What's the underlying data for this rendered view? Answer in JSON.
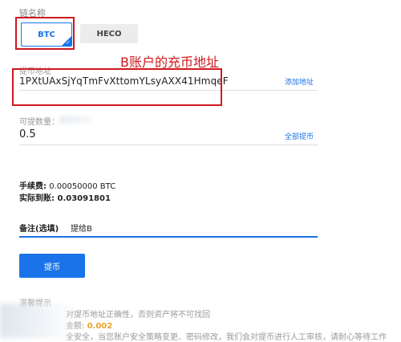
{
  "chain": {
    "label": "链名称",
    "options": [
      {
        "label": "BTC",
        "selected": true
      },
      {
        "label": "HECO",
        "selected": false
      }
    ],
    "checkmark": "✓"
  },
  "annotation": "B账户的充币地址",
  "address": {
    "label": "提币地址",
    "value": "1PXtUAxSjYqTmFvXttomYLsyAXX41HmqeF",
    "add_link": "添加地址"
  },
  "amount": {
    "label": "可提数量：",
    "value": "0.5",
    "all_link": "全部提币"
  },
  "fee": {
    "label": "手续费:",
    "value": "0.00050000 BTC"
  },
  "received": {
    "label": "实际到账:",
    "value": "0.03091801"
  },
  "memo": {
    "label": "备注(选填)",
    "value": "提给B"
  },
  "submit_label": "提币",
  "tips": {
    "title": "温馨提示",
    "line1": "对提币地址正确性，否则资产将不可找回",
    "line2_prefix": "金额:",
    "line2_value": "0.002",
    "line3": "全安全，当您账户安全策略变更、密码修改，我们会对提币进行人工审核，请耐心等待工作"
  },
  "colors": {
    "accent": "#1a73e8",
    "annotation": "#d0191f",
    "highlight": "#e8a32a"
  }
}
